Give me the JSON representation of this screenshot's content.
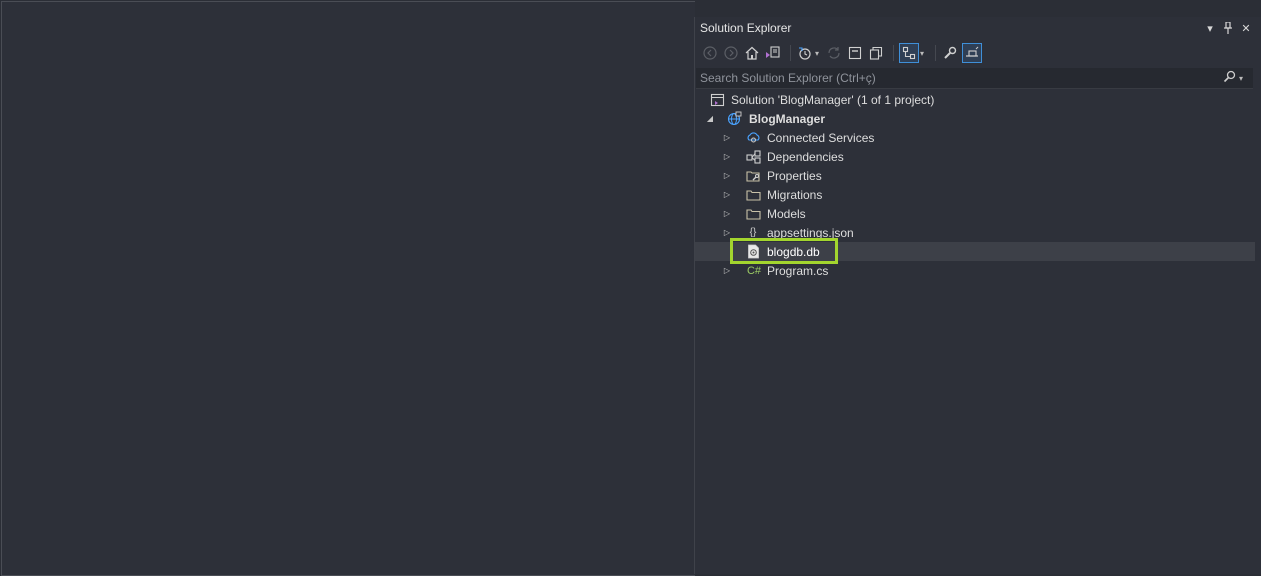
{
  "panel": {
    "title": "Solution Explorer",
    "title_buttons": [
      "▾",
      "⊥",
      "✕"
    ]
  },
  "search": {
    "placeholder": "Search Solution Explorer (Ctrl+ç)"
  },
  "toolbar": {
    "items": [
      "back-icon",
      "forward-icon",
      "home-icon",
      "switch-views-icon",
      "pending-changes-icon",
      "sync-icon",
      "collapse-all-icon",
      "show-all-files-icon",
      "track-active-icon",
      "properties-icon",
      "preview-selected-icon"
    ]
  },
  "tree": {
    "solution": "Solution 'BlogManager' (1 of 1 project)",
    "project": "BlogManager",
    "items": [
      {
        "label": "Connected Services",
        "icon": "connected-services-icon"
      },
      {
        "label": "Dependencies",
        "icon": "dependencies-icon"
      },
      {
        "label": "Properties",
        "icon": "properties-folder-icon"
      },
      {
        "label": "Migrations",
        "icon": "folder-icon"
      },
      {
        "label": "Models",
        "icon": "folder-icon"
      },
      {
        "label": "appsettings.json",
        "icon": "json-file-icon"
      },
      {
        "label": "blogdb.db",
        "icon": "db-file-icon"
      },
      {
        "label": "Program.cs",
        "icon": "csharp-file-icon"
      }
    ],
    "icon_text": {
      "json": "{}",
      "csharp": "C#"
    }
  },
  "colors": {
    "highlight": "#a3d52e",
    "selection": "#3d4048",
    "background": "#2d3039"
  }
}
